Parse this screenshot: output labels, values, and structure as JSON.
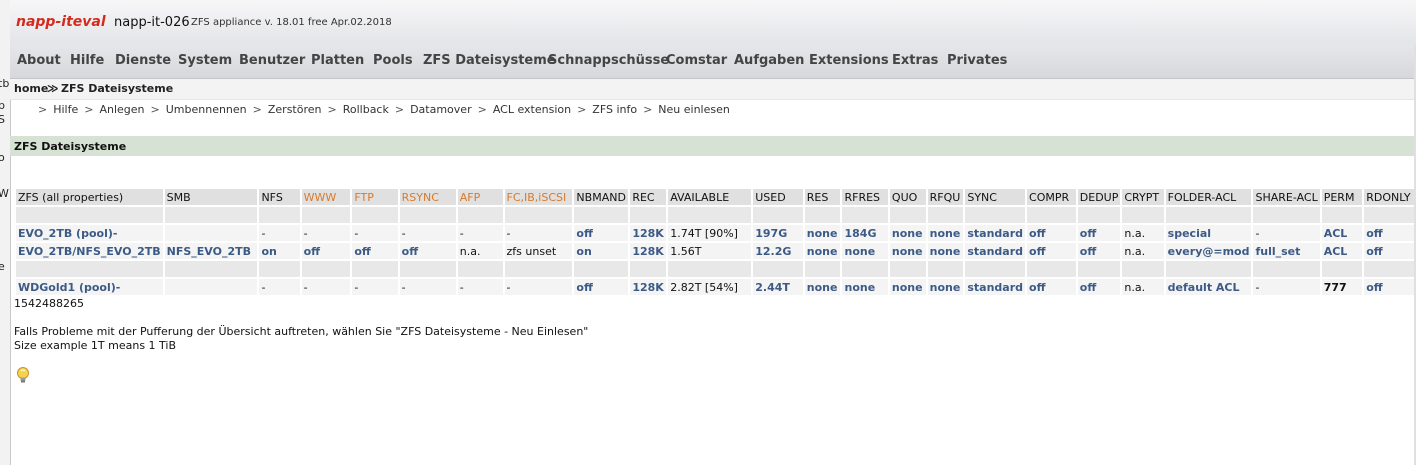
{
  "left_pane_fragments": [
    "tb",
    "p",
    "S",
    "o",
    "W",
    "e"
  ],
  "header": {
    "logo_main": "napp-it",
    "logo_suffix": "eval",
    "hostname": "napp-it-026",
    "version": "ZFS appliance v. 18.01 free Apr.02.2018"
  },
  "menu": [
    "About",
    "Hilfe",
    "Dienste",
    "System",
    "Benutzer",
    "Platten",
    "Pools",
    "ZFS Dateisysteme",
    "Schnappschüsse",
    "Comstar",
    "Aufgaben",
    "Extensions",
    "Extras",
    "Privates"
  ],
  "breadcrumb": {
    "home": "home",
    "sep": "≫",
    "current": "ZFS Dateisysteme"
  },
  "submenu": [
    "Hilfe",
    "Anlegen",
    "Umbennennen",
    "Zerstören",
    "Rollback",
    "Datamover",
    "ACL extension",
    "ZFS info",
    "Neu einlesen"
  ],
  "section_title": "ZFS Dateisysteme",
  "table": {
    "headers": [
      "ZFS (all properties)",
      "SMB",
      "NFS",
      "WWW",
      "FTP",
      "RSYNC",
      "AFP",
      "FC,IB,iSCSI",
      "NBMAND",
      "REC",
      "AVAILABLE",
      "USED",
      "RES",
      "RFRES",
      "QUO",
      "RFQU",
      "SYNC",
      "COMPR",
      "DEDUP",
      "CRYPT",
      "FOLDER-ACL",
      "SHARE-ACL",
      "PERM",
      "RDONLY"
    ],
    "rows": [
      [
        "EVO_2TB (pool)-",
        "",
        "-",
        "-",
        "-",
        "-",
        "-",
        "-",
        "off",
        "128K",
        "1.74T [90%]",
        "197G",
        "none",
        "184G",
        "none",
        "none",
        "standard",
        "off",
        "off",
        "n.a.",
        "special",
        "-",
        "ACL",
        "off"
      ],
      [
        "EVO_2TB/NFS_EVO_2TB",
        "NFS_EVO_2TB",
        "on",
        "off",
        "off",
        "off",
        "n.a.",
        "zfs unset",
        "on",
        "128K",
        "1.56T",
        "12.2G",
        "none",
        "none",
        "none",
        "none",
        "standard",
        "off",
        "off",
        "n.a.",
        "every@=mod",
        "full_set",
        "ACL",
        "off"
      ],
      [
        "WDGold1 (pool)-",
        "",
        "-",
        "-",
        "-",
        "-",
        "-",
        "-",
        "off",
        "128K",
        "2.82T [54%]",
        "2.44T",
        "none",
        "none",
        "none",
        "none",
        "standard",
        "off",
        "off",
        "n.a.",
        "default ACL",
        "-",
        "777",
        "off"
      ]
    ]
  },
  "below_table_number": "1542488265",
  "notes": [
    "Falls Probleme mit der Pufferung der Übersicht auftreten, wählen Sie \"ZFS Dateisysteme - Neu Einlesen\"",
    "Size example 1T means 1 TiB"
  ],
  "colors": {
    "accent_red": "#d42b1e",
    "link_blue": "#3c5a86",
    "header_orange": "#d77a2c",
    "section_green": "#d6e2d3"
  },
  "icons": [
    "lightbulb-icon"
  ]
}
